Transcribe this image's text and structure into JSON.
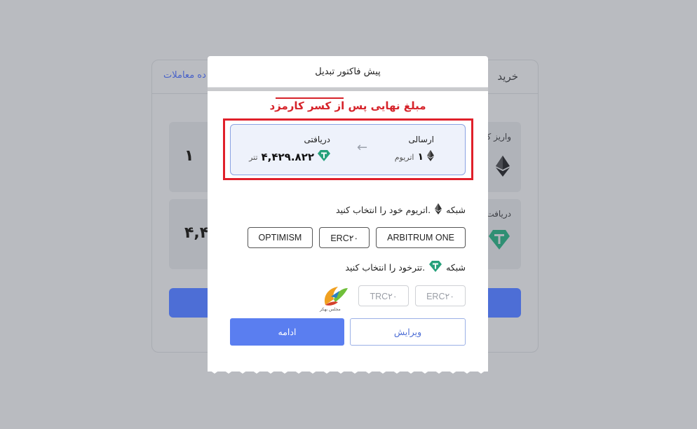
{
  "background": {
    "tab_title": "خرید",
    "history_link": "ده معاملات",
    "box1_label": "واریز ک",
    "box1_value": "۱",
    "box2_label": "دریافت",
    "box2_value": "۴,۴۲"
  },
  "modal": {
    "title": "پیش فاکتور تبدیل",
    "annotation": "مبلغ نهایی پس از کسر کارمزد",
    "send": {
      "title": "ارسالی",
      "amount": "۱",
      "unit": "اتریوم",
      "icon": "ethereum-icon"
    },
    "receive": {
      "title": "دریافتی",
      "amount": "۴,۴۲۹.۸۲۲",
      "unit": "تتر",
      "icon": "tether-icon"
    },
    "network_send": {
      "prefix": "شبکه",
      "suffix": "اتریوم خود را انتخاب کنید.",
      "options": [
        "ARBITRUM ONE",
        "ERC۲۰",
        "OPTIMISM"
      ]
    },
    "network_receive": {
      "prefix": "شبکه",
      "suffix": "تترخود را انتخاب کنید.",
      "options": [
        "ERC۲۰",
        "TRC۲۰"
      ]
    },
    "watermark_text": "مجلس بهکر",
    "buttons": {
      "continue": "ادامه",
      "edit": "ویرایش"
    },
    "colors": {
      "accent": "#5a7ef0",
      "annotation": "#d6232a",
      "tether": "#26a17b"
    }
  }
}
